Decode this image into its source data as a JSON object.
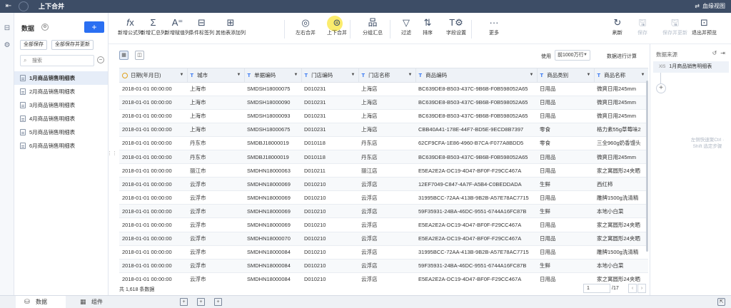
{
  "topbar": {
    "back_icon": "arrow-left-icon",
    "title": "上下合并",
    "right_label": "血缘视图",
    "right_icon": "lineage-icon"
  },
  "left_panel": {
    "title": "数据",
    "add_label": "+",
    "save_all": "全部保存",
    "save_all_update": "全部保存并更新",
    "search_placeholder": "搜索",
    "tables": [
      "1月商品销售明细表",
      "2月商品销售明细表",
      "3月商品销售明细表",
      "4月商品销售明细表",
      "5月商品销售明细表",
      "6月商品销售明细表"
    ],
    "active_index": 0
  },
  "toolbar": {
    "items": [
      {
        "icon": "𝑓x",
        "label": "新增公式列",
        "name": "formula-column"
      },
      {
        "icon": "Σ",
        "label": "新增汇总列",
        "name": "summary-column"
      },
      {
        "icon": "A⁼",
        "label": "新增赋值列",
        "name": "assign-column"
      },
      {
        "icon": "⊟",
        "label": "条件标签列",
        "name": "condition-tag-column"
      },
      {
        "icon": "⊞",
        "label": "其他表添加列",
        "name": "other-table-column"
      },
      {
        "icon": "◎",
        "label": "左右合并",
        "name": "left-right-merge"
      },
      {
        "icon": "⊜",
        "label": "上下合并",
        "name": "up-down-merge"
      },
      {
        "icon": "品",
        "label": "分组汇总",
        "name": "group-summary"
      },
      {
        "icon": "▽",
        "label": "过滤",
        "name": "filter"
      },
      {
        "icon": "⇅",
        "label": "排序",
        "name": "sort"
      },
      {
        "icon": "T⚙",
        "label": "字段设置",
        "name": "field-settings"
      },
      {
        "icon": "···",
        "label": "更多",
        "name": "more"
      }
    ],
    "right_items": [
      {
        "icon": "↻",
        "label": "刷新",
        "name": "refresh",
        "disabled": false
      },
      {
        "icon": "🖫",
        "label": "保存",
        "name": "save",
        "disabled": true
      },
      {
        "icon": "🖫",
        "label": "保存并更新",
        "name": "save-update",
        "disabled": true
      },
      {
        "icon": "⊡",
        "label": "退出并预览",
        "name": "exit-preview",
        "disabled": false
      }
    ]
  },
  "subbar": {
    "use_label": "使用",
    "rows_select": "前1000万行",
    "calc_label": "数据进行计算"
  },
  "grid": {
    "columns": [
      {
        "type": "date",
        "label": "日期(年月日)"
      },
      {
        "type": "T",
        "label": "城市"
      },
      {
        "type": "T",
        "label": "单据编码"
      },
      {
        "type": "T",
        "label": "门店编码"
      },
      {
        "type": "T",
        "label": "门店名称"
      },
      {
        "type": "T",
        "label": "商品编码"
      },
      {
        "type": "T",
        "label": "商品类别"
      },
      {
        "type": "T",
        "label": "商品名称"
      }
    ],
    "rows": [
      [
        "2018-01-01 00:00:00",
        "上海市",
        "SMDSH18000075",
        "D010231",
        "上海店",
        "BC639DE8-B503-437C-9B6B-F0B598052A65",
        "日用品",
        "微爽日用245mm"
      ],
      [
        "2018-01-01 00:00:00",
        "上海市",
        "SMDSH18000090",
        "D010231",
        "上海店",
        "BC639DE8-B503-437C-9B6B-F0B598052A65",
        "日用品",
        "微爽日用245mm"
      ],
      [
        "2018-01-01 00:00:00",
        "上海市",
        "SMDSH18000093",
        "D010231",
        "上海店",
        "BC639DE8-B503-437C-9B6B-F0B598052A65",
        "日用品",
        "微爽日用245mm"
      ],
      [
        "2018-01-01 00:00:00",
        "上海市",
        "SMDSH18000675",
        "D010231",
        "上海店",
        "CBB40A41-178E-44F7-BD5E-9ECD8B7397",
        "零食",
        "格力素55g草莓味2"
      ],
      [
        "2018-01-01 00:00:00",
        "丹东市",
        "SMDBJ18000019",
        "D010118",
        "丹东店",
        "62CF9CFA-1E86-4960-B7CA-F077A8BDD5",
        "零食",
        "三全960g奶香馒头"
      ],
      [
        "2018-01-01 00:00:00",
        "丹东市",
        "SMDBJ18000019",
        "D010118",
        "丹东店",
        "BC639DE8-B503-437C-9B6B-F0B598052A65",
        "日用品",
        "微爽日用245mm"
      ],
      [
        "2018-01-01 00:00:00",
        "丽江市",
        "SMDHN18000063",
        "D010211",
        "丽江店",
        "E5EA2E2A-DC19-4D47-BF0F-F29CC467A",
        "日用品",
        "家之寓圆形24夹晒"
      ],
      [
        "2018-01-01 00:00:00",
        "云浮市",
        "SMDHN18000069",
        "D010210",
        "云浮店",
        "12EF7049-C847-4A7F-A5B4-C0BEDDADA",
        "生鲜",
        "西红柿"
      ],
      [
        "2018-01-01 00:00:00",
        "云浮市",
        "SMDHN18000069",
        "D010210",
        "云浮店",
        "31995BCC-72AA-413B-9B2B-A57E78AC7715",
        "日用品",
        "雕牌1500g洗清精"
      ],
      [
        "2018-01-01 00:00:00",
        "云浮市",
        "SMDHN18000069",
        "D010210",
        "云浮店",
        "59F35931-24BA-46DC-9551-6744A16FC87B",
        "生鲜",
        "本地小白菜"
      ],
      [
        "2018-01-01 00:00:00",
        "云浮市",
        "SMDHN18000069",
        "D010210",
        "云浮店",
        "E5EA2E2A-DC19-4D47-BF0F-F29CC467A",
        "日用品",
        "家之寓圆形24夹晒"
      ],
      [
        "2018-01-01 00:00:00",
        "云浮市",
        "SMDHN18000070",
        "D010210",
        "云浮店",
        "E5EA2E2A-DC19-4D47-BF0F-F29CC467A",
        "日用品",
        "家之寓圆形24夹晒"
      ],
      [
        "2018-01-01 00:00:00",
        "云浮市",
        "SMDHN18000084",
        "D010210",
        "云浮店",
        "31995BCC-72AA-413B-9B2B-A57E78AC7715",
        "日用品",
        "雕牌1500g洗清精"
      ],
      [
        "2018-01-01 00:00:00",
        "云浮市",
        "SMDHN18000084",
        "D010210",
        "云浮店",
        "59F35931-24BA-46DC-9551-6744A16FC87B",
        "生鲜",
        "本地小白菜"
      ],
      [
        "2018-01-01 00:00:00",
        "云浮市",
        "SMDHN18000084",
        "D010210",
        "云浮店",
        "E5EA2E2A-DC19-4D47-BF0F-F29CC467A",
        "日用品",
        "家之寓圆形24夹晒"
      ]
    ]
  },
  "footer": {
    "count_text": "共 1,618 条数据",
    "page_current": "1",
    "page_total": "/17",
    "prev": "‹",
    "next": "›"
  },
  "right_panel": {
    "title": "数据来源",
    "source_item": "1月商品销售明细表",
    "source_prefix": "XlS",
    "hint": "左侧快速聚Ctrl · Shift 选定步骤"
  },
  "bottombar": {
    "tab_data": "数据",
    "tab_component": "组件"
  }
}
